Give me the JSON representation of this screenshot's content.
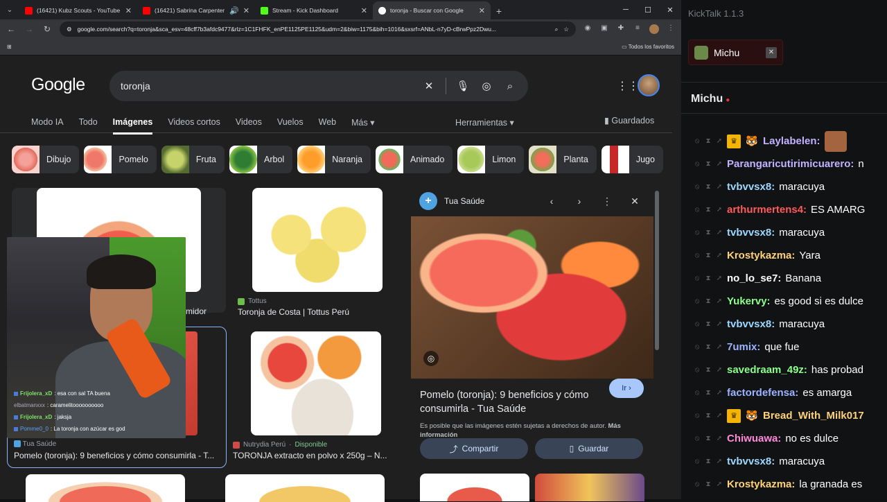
{
  "browser": {
    "tabs": [
      {
        "label": "(16421) Kubz Scouts - YouTube",
        "favicon_color": "#ff0000"
      },
      {
        "label": "(16421) Sabrina Carpenter",
        "favicon_color": "#ff0000"
      },
      {
        "label": "Stream - Kick Dashboard",
        "favicon_color": "#53fc18"
      },
      {
        "label": "toronja - Buscar con Google",
        "favicon_color": "#ffffff"
      }
    ],
    "url": "google.com/search?q=toronja&sca_esv=48cff7b3afdc9477&rlz=1C1FHFK_enPE1125PE1125&udm=2&biw=1175&bih=1016&sxsrf=ANbL-n7yD-cBrwPpz2Dwu...",
    "bookmarks_all": "Todos los favoritos"
  },
  "google": {
    "logo": "Google",
    "query": "toronja",
    "tabs": [
      "Modo IA",
      "Todo",
      "Imágenes",
      "Videos cortos",
      "Videos",
      "Vuelos",
      "Web",
      "Más ▾"
    ],
    "tools": "Herramientas ▾",
    "saved": "Guardados",
    "chips": [
      {
        "label": "Dibujo",
        "cls": "draw"
      },
      {
        "label": "Pomelo",
        "cls": "pomelo"
      },
      {
        "label": "Fruta",
        "cls": "fruta"
      },
      {
        "label": "Arbol",
        "cls": "arbol"
      },
      {
        "label": "Naranja",
        "cls": "naranja"
      },
      {
        "label": "Animado",
        "cls": "animado"
      },
      {
        "label": "Limon",
        "cls": "limon"
      },
      {
        "label": "Planta",
        "cls": "planta"
      },
      {
        "label": "Jugo",
        "cls": "jugo"
      }
    ],
    "result1_caption_fragment": "midor",
    "result2": {
      "source": "Tottus",
      "title": "Toronja de Costa | Tottus Perú"
    },
    "result3": {
      "source": "Tua Saúde",
      "title": "Pomelo (toronja): 9 beneficios y cómo consumirla - T..."
    },
    "result4": {
      "source": "Nutrydia Perú",
      "stock": "Disponible",
      "title": "TORONJA extracto en polvo x 250g – N..."
    }
  },
  "panel": {
    "source": "Tua Saúde",
    "title": "Pomelo (toronja): 9 beneficios y cómo consumirla - Tua Saúde",
    "go": "Ir",
    "note": "Es posible que las imágenes estén sujetas a derechos de autor.",
    "note_link": "Más información",
    "share": "Compartir",
    "save": "Guardar"
  },
  "overlay_chat": [
    {
      "user": "Frijolera_xD",
      "text": ": esa con sal TA buena",
      "cls": "un"
    },
    {
      "user": "elbatmanxxx",
      "text": ": caramelitoooooooooo",
      "cls": "un2"
    },
    {
      "user": "Frijolera_xD",
      "text": ": jaksja",
      "cls": "un"
    },
    {
      "user": "Pomme0_0",
      "text": ": La toronja con azúcar es god",
      "cls": "un3"
    }
  ],
  "kicktalk": {
    "title": "KickTalk 1.1.3",
    "tab_user": "Michu",
    "channel": "Michu",
    "messages": [
      {
        "user": "Laylabelen:",
        "text": "",
        "color": "#c3b2ff",
        "badges": [
          "crown",
          "tiger"
        ],
        "emote": true
      },
      {
        "user": "Parangaricutirimicuarero:",
        "text": "n",
        "color": "#c3b2ff",
        "badges": []
      },
      {
        "user": "tvbvvsx8:",
        "text": "maracuya",
        "color": "#9ed8ff",
        "badges": []
      },
      {
        "user": "arthurmertens4:",
        "text": "ES AMARG",
        "color": "#ff5a5a",
        "badges": []
      },
      {
        "user": "tvbvvsx8:",
        "text": "maracuya",
        "color": "#9ed8ff",
        "badges": []
      },
      {
        "user": "Krostykazma:",
        "text": "Yara",
        "color": "#ffd27a",
        "badges": []
      },
      {
        "user": "no_lo_se7:",
        "text": "Banana",
        "color": "#ffffff",
        "badges": []
      },
      {
        "user": "Yukervy:",
        "text": "es good si es dulce",
        "color": "#8bff8b",
        "badges": []
      },
      {
        "user": "tvbvvsx8:",
        "text": "maracuya",
        "color": "#9ed8ff",
        "badges": []
      },
      {
        "user": "7umix:",
        "text": "que fue",
        "color": "#9db3ff",
        "badges": []
      },
      {
        "user": "savedraam_49z:",
        "text": "has probad",
        "color": "#8bff8b",
        "badges": []
      },
      {
        "user": "factordefensa:",
        "text": "es amarga",
        "color": "#9db3ff",
        "badges": []
      },
      {
        "user": "Bread_With_Milk017",
        "text": "",
        "color": "#ffd27a",
        "badges": [
          "crown",
          "tiger"
        ]
      },
      {
        "user": "Chiwuawa:",
        "text": "no es dulce",
        "color": "#ff8ad8",
        "badges": []
      },
      {
        "user": "tvbvvsx8:",
        "text": "maracuya",
        "color": "#9ed8ff",
        "badges": []
      },
      {
        "user": "Krostykazma:",
        "text": "la granada es",
        "color": "#ffd27a",
        "badges": []
      }
    ]
  }
}
